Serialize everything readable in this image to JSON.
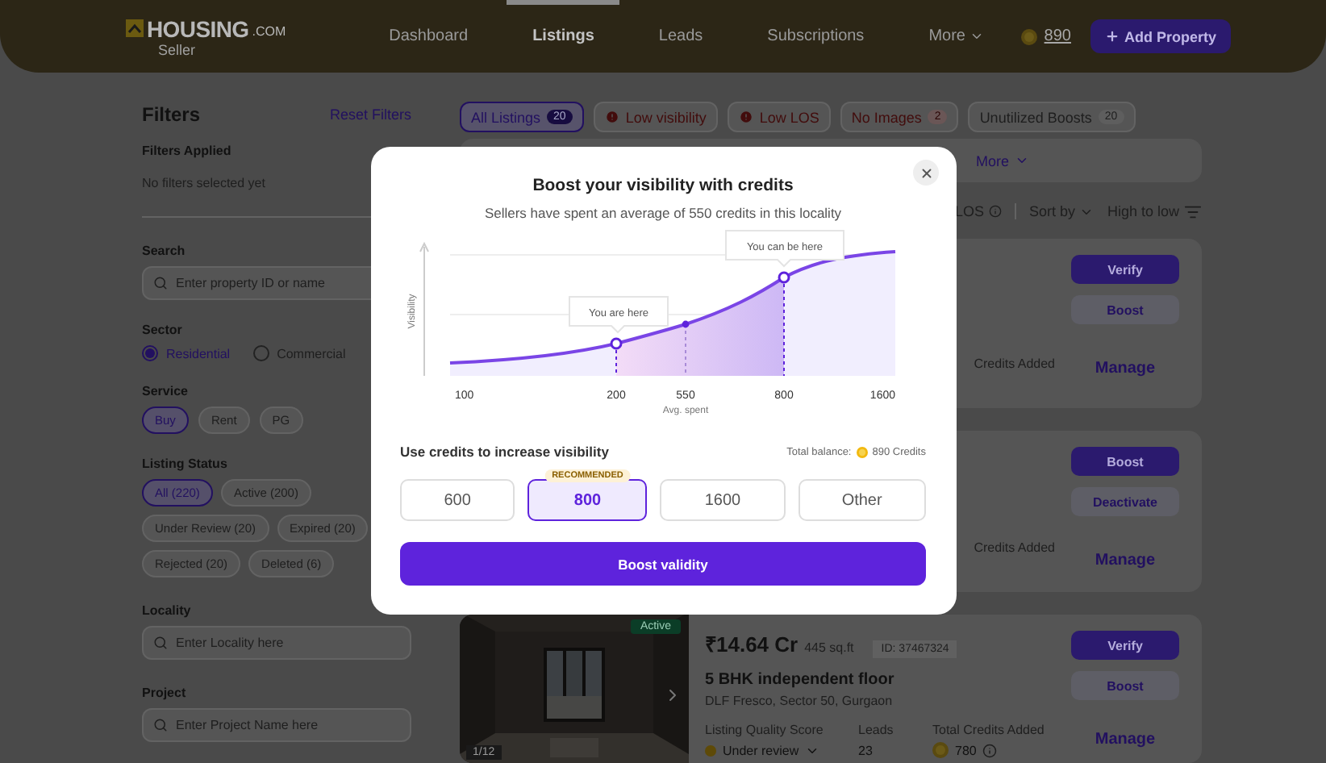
{
  "header": {
    "logo": "HOUSING",
    "logo_domain": ".COM",
    "logo_caption": "Seller",
    "nav": [
      {
        "label": "Dashboard",
        "selected": false,
        "dropdown": false
      },
      {
        "label": "Listings",
        "selected": true,
        "dropdown": false
      },
      {
        "label": "Leads",
        "selected": false,
        "dropdown": false
      },
      {
        "label": "Subscriptions",
        "selected": false,
        "dropdown": false
      },
      {
        "label": "More",
        "selected": false,
        "dropdown": true
      }
    ],
    "credits": "890",
    "add_button": "Add Property"
  },
  "filters": {
    "title": "Filters",
    "reset": "Reset Filters",
    "applied_label": "Filters Applied",
    "applied_text": "No filters selected yet",
    "search": {
      "label": "Search",
      "placeholder": "Enter property ID or name"
    },
    "sector": {
      "label": "Sector",
      "options": [
        {
          "label": "Residential",
          "selected": true
        },
        {
          "label": "Commercial",
          "selected": false
        }
      ]
    },
    "service": {
      "label": "Service",
      "options": [
        {
          "label": "Buy",
          "selected": true
        },
        {
          "label": "Rent",
          "selected": false
        },
        {
          "label": "PG",
          "selected": false
        }
      ]
    },
    "listing_status": {
      "label": "Listing Status",
      "options": [
        {
          "label": "All (220)",
          "selected": true
        },
        {
          "label": "Active (200)",
          "selected": false
        },
        {
          "label": "Under Review (20)",
          "selected": false
        },
        {
          "label": "Expired (20)",
          "selected": false
        },
        {
          "label": "Rejected (20)",
          "selected": false
        },
        {
          "label": "Deleted (6)",
          "selected": false
        }
      ]
    },
    "locality": {
      "label": "Locality",
      "placeholder": "Enter Locality here"
    },
    "project": {
      "label": "Project",
      "placeholder": "Enter Project Name here"
    }
  },
  "tabs": [
    {
      "label": "All Listings",
      "count": "20",
      "selected": true,
      "kind": "count"
    },
    {
      "label": "Low visibility",
      "selected": false,
      "kind": "alert"
    },
    {
      "label": "Low LOS",
      "selected": false,
      "kind": "alert"
    },
    {
      "label": "No Images",
      "count": "2",
      "selected": false,
      "kind": "issue"
    },
    {
      "label": "Unutilized Boosts",
      "count": "20",
      "selected": false,
      "kind": "count"
    }
  ],
  "more_filters": "More",
  "sort": {
    "los_label": "LOS",
    "label": "Sort by",
    "value": "High to low"
  },
  "listings": [
    {
      "actions": [
        {
          "label": "Verify",
          "kind": "primary"
        },
        {
          "label": "Boost",
          "kind": "secondary"
        }
      ],
      "stat_label": "Credits Added",
      "manage": "Manage"
    },
    {
      "actions": [
        {
          "label": "Boost",
          "kind": "primary"
        },
        {
          "label": "Deactivate",
          "kind": "secondary"
        }
      ],
      "stat_label": "Credits Added",
      "manage": "Manage"
    },
    {
      "status": "Active",
      "photo_counter": "1/12",
      "price": "₹14.64 Cr",
      "area": "445 sq.ft",
      "id": "ID: 37467324",
      "title": "5 BHK independent floor",
      "location": "DLF Fresco, Sector 50, Gurgaon",
      "stats": [
        {
          "label": "Listing Quality Score",
          "value": "Under review",
          "kind": "status"
        },
        {
          "label": "Leads",
          "value": "23",
          "kind": "plain"
        },
        {
          "label": "Total Credits Added",
          "value": "780",
          "kind": "credits"
        }
      ],
      "actions": [
        {
          "label": "Verify",
          "kind": "primary"
        },
        {
          "label": "Boost",
          "kind": "secondary"
        }
      ],
      "manage": "Manage"
    }
  ],
  "modal": {
    "title": "Boost your visibility with credits",
    "subtitle": "Sellers have spent an average of 550 credits in this locality",
    "chart": {
      "y_label": "Visibility",
      "x_label": "Avg. spent",
      "ticks": [
        "100",
        "200",
        "550",
        "800",
        "1600"
      ],
      "current_callout": "You are here",
      "target_callout": "You can be here"
    },
    "prompt": "Use credits to increase visibility",
    "balance_label": "Total balance:",
    "balance": "890 Credits",
    "options": [
      {
        "label": "600",
        "selected": false
      },
      {
        "label": "800",
        "selected": true,
        "badge": "RECOMMENDED"
      },
      {
        "label": "1600",
        "selected": false
      },
      {
        "label": "Other",
        "selected": false
      }
    ],
    "cta": "Boost validity"
  }
}
